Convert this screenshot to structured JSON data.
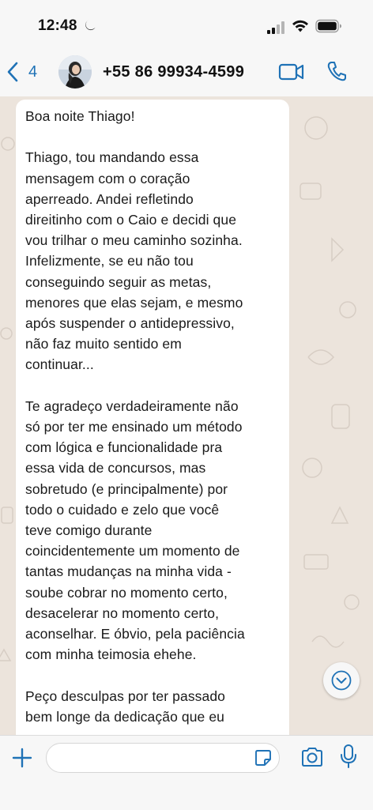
{
  "status_bar": {
    "time": "12:48",
    "icons": [
      "moon-icon",
      "signal-icon",
      "wifi-icon",
      "battery-icon"
    ]
  },
  "header": {
    "back_count": "4",
    "contact_name": "+55 86 99934-4599",
    "icons": [
      "chevron-left-icon",
      "avatar",
      "video-call-icon",
      "phone-icon"
    ]
  },
  "chat": {
    "message": "Boa noite Thiago!\n\nThiago, tou mandando essa\nmensagem com o coração\naperreado. Andei refletindo\ndireitinho com o Caio e decidi que\nvou trilhar o meu caminho sozinha.\nInfelizmente, se eu não tou\nconseguindo seguir as metas,\nmenores que elas sejam, e mesmo\napós suspender o antidepressivo,\nnão faz muito sentido em\ncontinuar...\n\nTe agradeço verdadeiramente não\nsó por ter me ensinado um método\ncom lógica e funcionalidade pra\nessa vida de concursos, mas\nsobretudo (e principalmente) por\ntodo o cuidado e zelo que você\nteve comigo durante\ncoincidentemente um momento de\ntantas mudanças na minha vida -\nsoube cobrar no momento certo,\ndesacelerar no momento certo,\naconselhar. E óbvio, pela paciência\ncom minha teimosia ehehe.\n\nPeço desculpas por ter passado\nbem longe da dedicação que eu"
  },
  "input_bar": {
    "value": "",
    "placeholder": "",
    "icons": [
      "plus-icon",
      "sticker-icon",
      "camera-icon",
      "microphone-icon"
    ]
  },
  "colors": {
    "accent": "#1f72b6",
    "chat_background": "#ece4dc",
    "bubble": "#ffffff",
    "bar_background": "#f7f7f7"
  }
}
